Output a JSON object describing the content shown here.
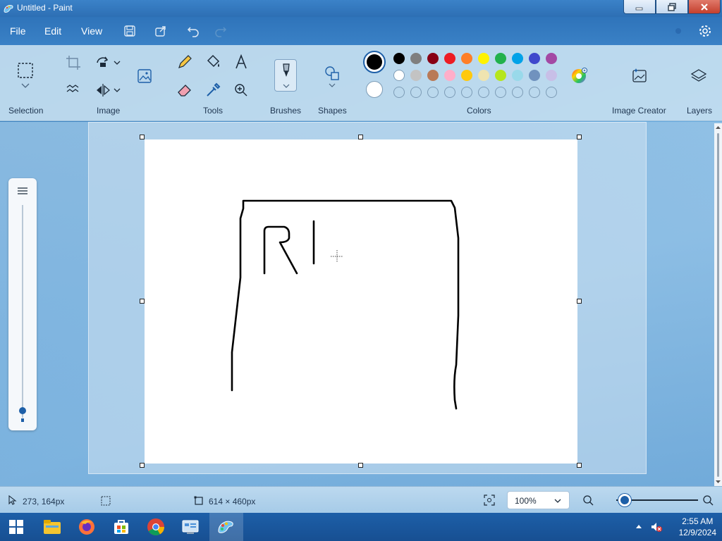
{
  "window": {
    "title": "Untitled - Paint"
  },
  "menu": {
    "file": "File",
    "edit": "Edit",
    "view": "View"
  },
  "ribbon": {
    "groups": {
      "selection": "Selection",
      "image": "Image",
      "tools": "Tools",
      "brushes": "Brushes",
      "shapes": "Shapes",
      "colors": "Colors",
      "image_creator": "Image Creator",
      "layers": "Layers"
    },
    "primary_color": "#000000",
    "secondary_color": "#ffffff",
    "palette_row1": [
      "#000000",
      "#7f7f7f",
      "#880015",
      "#ed1c24",
      "#ff7f27",
      "#fff200",
      "#22b14c",
      "#00a2e8",
      "#3f48cc",
      "#a349a4"
    ],
    "palette_row2": [
      "#ffffff",
      "#c3c3c3",
      "#b97a57",
      "#ffaec9",
      "#ffc90e",
      "#efe4b0",
      "#b5e61d",
      "#99d9ea",
      "#7092be",
      "#c8bfe7"
    ]
  },
  "status": {
    "cursor_position": "273, 164px",
    "canvas_size": "614 × 460px",
    "zoom": "100%",
    "zoom_level": 0.1
  },
  "taskbar": {
    "time": "2:55 AM",
    "date": "12/9/2024"
  }
}
